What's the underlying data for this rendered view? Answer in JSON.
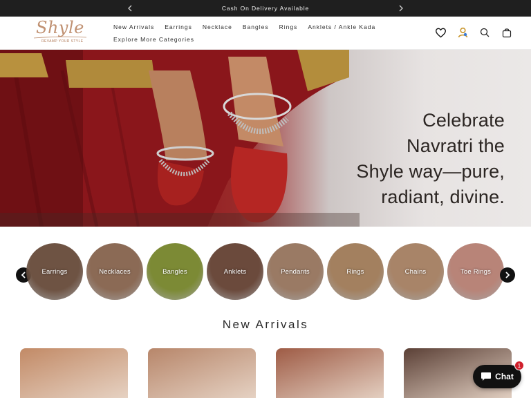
{
  "announcement": {
    "message": "Cash On Delivery Available",
    "prev_icon": "chevron-left-icon",
    "next_icon": "chevron-right-icon"
  },
  "header": {
    "logo_text": "Shyle",
    "logo_tagline": "REVAMP YOUR STYLE",
    "nav": {
      "row1": [
        "New Arrivals",
        "Earrings",
        "Necklace",
        "Bangles",
        "Rings",
        "Anklets / Ankle Kada"
      ],
      "row2": [
        "Explore More Categories"
      ]
    },
    "icons": [
      "heart-icon",
      "account-icon",
      "search-icon",
      "bag-icon"
    ]
  },
  "hero": {
    "headline_lines": [
      "Celebrate",
      "Navratri the",
      "Shyle way—pure,",
      "radiant, divine."
    ]
  },
  "categories": {
    "items": [
      {
        "label": "Earrings",
        "color": "#6e5343"
      },
      {
        "label": "Necklaces",
        "color": "#8b6a55"
      },
      {
        "label": "Bangles",
        "color": "#7c8a35"
      },
      {
        "label": "Anklets",
        "color": "#6b4a3c"
      },
      {
        "label": "Pendants",
        "color": "#9a7a64"
      },
      {
        "label": "Rings",
        "color": "#a3805f"
      },
      {
        "label": "Chains",
        "color": "#a88468"
      },
      {
        "label": "Toe Rings",
        "color": "#b88478"
      }
    ],
    "prev_icon": "arrow-left-icon",
    "next_icon": "arrow-right-icon"
  },
  "new_arrivals": {
    "title": "New Arrivals",
    "products": [
      {
        "color": "#c28a66"
      },
      {
        "color": "#b7866a"
      },
      {
        "color": "#9e5b45"
      },
      {
        "color": "#5b4036"
      }
    ]
  },
  "chat": {
    "label": "Chat",
    "badge": "1",
    "icon": "chat-bubble-icon"
  }
}
